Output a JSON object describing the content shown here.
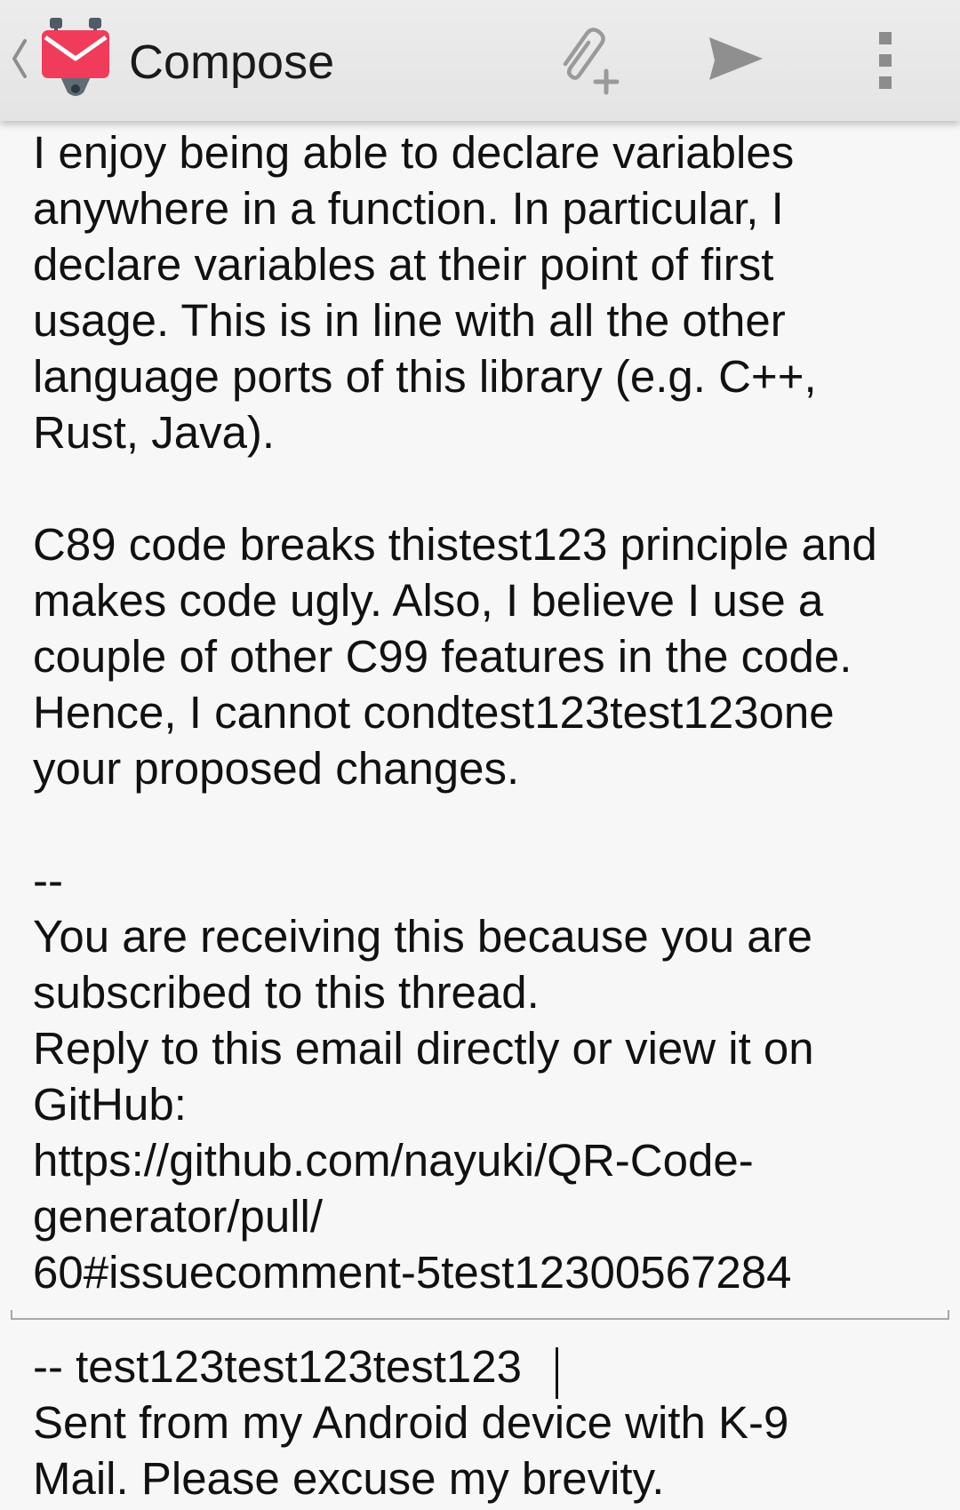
{
  "action_bar": {
    "title": "Compose",
    "icons": {
      "back": "chevron-left-icon",
      "app": "k9-mail-icon",
      "attach": "add-attachment-icon",
      "send": "send-icon",
      "overflow": "overflow-menu-icon"
    },
    "brand_color": "#f03c5a"
  },
  "body": {
    "quoted_text": "I enjoy being able to declare variables\nanywhere in a function. In particular, I\ndeclare variables at their point of first\nusage. This is in line with all the other\nlanguage ports of this library (e.g. C++,\nRust, Java).\n\nC89 code breaks thistest123 principle and\nmakes code ugly. Also, I believe I use a\ncouple of other C99 features in the code.\nHence, I cannot condtest123test123one\nyour proposed changes.\n\n--\nYou are receiving this because you are\nsubscribed to this thread.\nReply to this email directly or view it on\nGitHub:\nhttps://github.com/nayuki/QR-Code-\ngenerator/pull/\n60#issuecomment-5test12300567284",
    "signature": "-- test123test123test123\nSent from my Android device with K-9\nMail. Please excuse my brevity."
  }
}
